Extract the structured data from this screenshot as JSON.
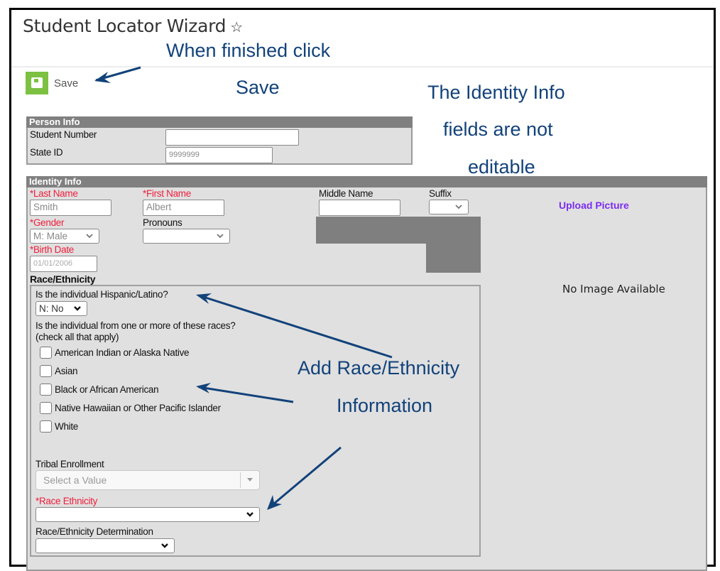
{
  "page": {
    "title": "Student Locator Wizard",
    "favorite_icon": "star-outline-icon"
  },
  "toolbar": {
    "save_label": "Save",
    "save_icon": "floppy-disk-icon"
  },
  "annotations": {
    "save_line1": "When finished click",
    "save_line2": "Save",
    "identity_line1": "The Identity Info",
    "identity_line2": "fields are not",
    "identity_line3": "editable",
    "race_line1": "Add Race/Ethnicity",
    "race_line2": "Information",
    "arrow_color": "#12427a"
  },
  "person_info": {
    "header": "Person Info",
    "student_number_label": "Student Number",
    "student_number_value": "",
    "state_id_label": "State ID",
    "state_id_value": "9999999"
  },
  "identity_info": {
    "header": "Identity Info",
    "last_name_label": "*Last Name",
    "last_name_value": "Smith",
    "first_name_label": "*First Name",
    "first_name_value": "Albert",
    "middle_name_label": "Middle Name",
    "middle_name_value": "",
    "suffix_label": "Suffix",
    "suffix_value": "",
    "gender_label": "*Gender",
    "gender_value": "M: Male",
    "pronouns_label": "Pronouns",
    "pronouns_value": "",
    "birth_date_label": "*Birth Date",
    "birth_date_value": "01/01/2006",
    "upload_picture": "Upload Picture",
    "no_image": "No Image Available",
    "required_color": "#ee1f3c",
    "link_color": "#7b2cf0"
  },
  "race_ethnicity": {
    "label": "Race/Ethnicity",
    "hispanic_question": "Is the individual Hispanic/Latino?",
    "hispanic_value": "N: No",
    "races_question_line1": "Is the individual from one or more of these races?",
    "races_question_line2": "(check all that apply)",
    "races": [
      {
        "label": "American Indian or Alaska Native",
        "checked": false
      },
      {
        "label": "Asian",
        "checked": false
      },
      {
        "label": "Black or African American",
        "checked": false
      },
      {
        "label": "Native Hawaiian or Other Pacific Islander",
        "checked": false
      },
      {
        "label": "White",
        "checked": false
      }
    ],
    "tribal_label": "Tribal Enrollment",
    "tribal_placeholder": "Select a Value",
    "race_ethnicity_label": "*Race Ethnicity",
    "race_ethnicity_value": "",
    "determination_label": "Race/Ethnicity Determination",
    "determination_value": ""
  }
}
